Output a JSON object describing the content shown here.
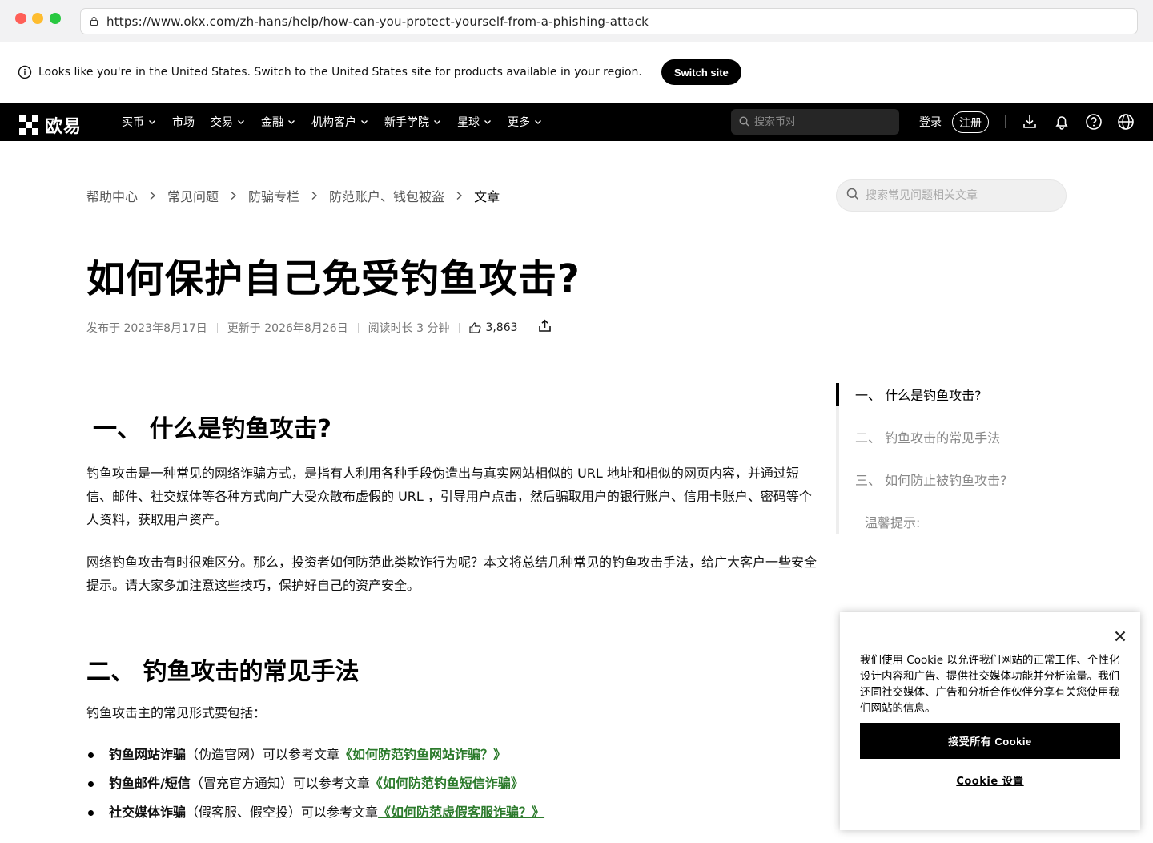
{
  "browser": {
    "url": "https://www.okx.com/zh-hans/help/how-can-you-protect-yourself-from-a-phishing-attack"
  },
  "region_banner": {
    "message": "Looks like you're in the United States. Switch to the United States site for products available in your region.",
    "button": "Switch site"
  },
  "nav": {
    "logo_text": "欧易",
    "items": [
      {
        "label": "买币",
        "has_dropdown": true
      },
      {
        "label": "市场",
        "has_dropdown": false
      },
      {
        "label": "交易",
        "has_dropdown": true
      },
      {
        "label": "金融",
        "has_dropdown": true
      },
      {
        "label": "机构客户",
        "has_dropdown": true
      },
      {
        "label": "新手学院",
        "has_dropdown": true
      },
      {
        "label": "星球",
        "has_dropdown": true
      },
      {
        "label": "更多",
        "has_dropdown": true
      }
    ],
    "search_placeholder": "搜索币对",
    "login": "登录",
    "signup": "注册"
  },
  "breadcrumb": {
    "items": [
      "帮助中心",
      "常见问题",
      "防骗专栏",
      "防范账户、钱包被盗",
      "文章"
    ]
  },
  "help_search_placeholder": "搜索常见问题相关文章",
  "article": {
    "title": "如何保护自己免受钓鱼攻击?",
    "published": "发布于 2023年8月17日",
    "updated": "更新于 2026年8月26日",
    "read_time": "阅读时长 3 分钟",
    "likes": "3,863",
    "section1_title": "一、 什么是钓鱼攻击?",
    "section1_p1": "钓鱼攻击是一种常见的网络诈骗方式，是指有人利用各种手段伪造出与真实网站相似的 URL 地址和相似的网页内容，并通过短信、邮件、社交媒体等各种方式向广大受众散布虚假的 URL ，引导用户点击，然后骗取用户的银行账户、信用卡账户、密码等个人资料，获取用户资产。",
    "section1_p2": "网络钓鱼攻击有时很难区分。那么，投资者如何防范此类欺诈行为呢？本文将总结几种常见的钓鱼攻击手法，给广大客户一些安全提示。请大家多加注意这些技巧，保护好自己的资产安全。",
    "section2_title": "二、 钓鱼攻击的常见手法",
    "section2_intro": "钓鱼攻击主的常见形式要包括：",
    "bullets": [
      {
        "bold": "钓鱼网站诈骗",
        "text": "（伪造官网）可以参考文章",
        "link": "《如何防范钓鱼网站诈骗？》"
      },
      {
        "bold": "钓鱼邮件/短信",
        "text": "（冒充官方通知）可以参考文章",
        "link": "《如何防范钓鱼短信诈骗》"
      },
      {
        "bold": "社交媒体诈骗",
        "text": "（假客服、假空投）可以参考文章",
        "link": "《如何防范虚假客服诈骗？》"
      }
    ]
  },
  "toc": {
    "items": [
      "一、 什么是钓鱼攻击?",
      "二、 钓鱼攻击的常见手法",
      "三、 如何防止被钓鱼攻击?",
      "温馨提示:"
    ]
  },
  "cookie": {
    "text": "我们使用 Cookie 以允许我们网站的正常工作、个性化设计内容和广告、提供社交媒体功能并分析流量。我们还同社交媒体、广告和分析合作伙伴分享有关您使用我们网站的信息。",
    "accept": "接受所有 Cookie",
    "settings": "Cookie 设置"
  },
  "colors": {
    "nav_bg": "#000000",
    "link_green": "#2b7a2b"
  }
}
